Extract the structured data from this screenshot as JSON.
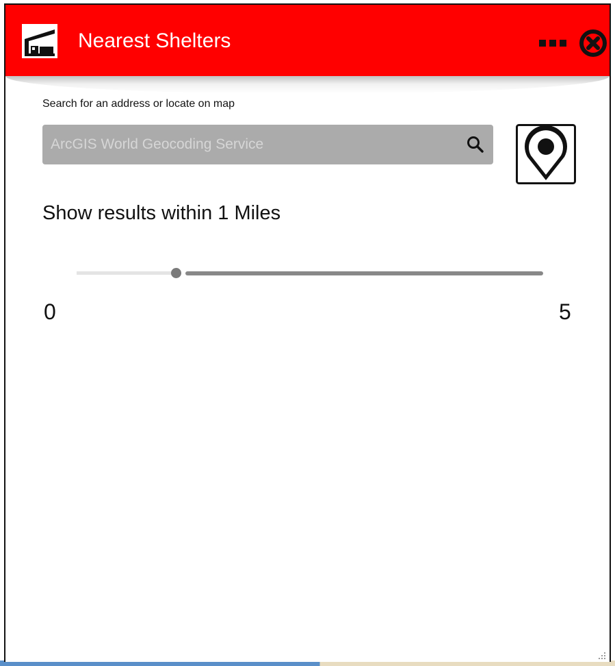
{
  "header": {
    "title": "Nearest Shelters",
    "icon": "shelter-icon",
    "more_icon": "more-dots-icon",
    "close_icon": "close-icon",
    "background": "#ff0000"
  },
  "search": {
    "caption": "Search for an address or locate on map",
    "placeholder": "ArcGIS World Geocoding Service",
    "value": "",
    "search_icon": "search-icon",
    "locate_icon": "map-pin-icon"
  },
  "radius": {
    "label": "Show results within 1 Miles",
    "value": 1,
    "unit": "Miles",
    "min": 0,
    "max": 5,
    "min_label": "0",
    "max_label": "5"
  }
}
